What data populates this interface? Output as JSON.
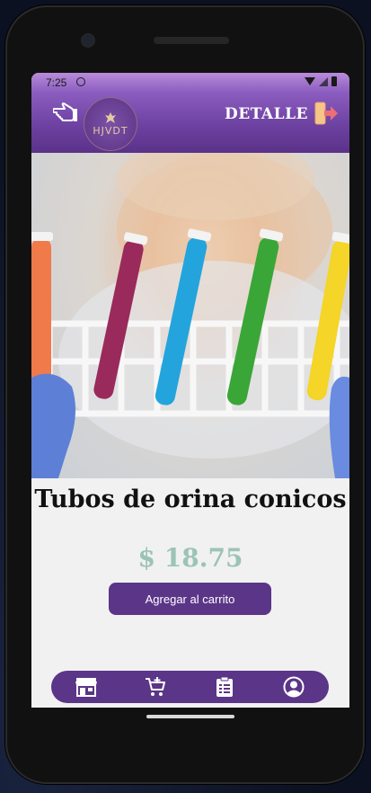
{
  "status_bar": {
    "time": "7:25"
  },
  "header": {
    "title": "DETALLE",
    "logo_text": "HJVDT",
    "back_icon": "hand-pointing-left-icon",
    "logout_icon": "exit-door-icon",
    "gradient_top": "#b88bd9",
    "gradient_bottom": "#5a3289"
  },
  "product": {
    "name": "Tubos de orina conicos",
    "price": "$ 18.75",
    "price_color": "#9cc4b6",
    "image_alt": "test-tubes-rack-photo",
    "add_to_cart_label": "Agregar al carrito"
  },
  "bottom_nav": {
    "items": [
      {
        "icon": "store-icon"
      },
      {
        "icon": "add-to-cart-icon"
      },
      {
        "icon": "clipboard-list-icon"
      },
      {
        "icon": "user-profile-icon"
      }
    ],
    "background": "#5b3587"
  },
  "colors": {
    "accent": "#5b3587",
    "screen_bg": "#f1f1f1"
  }
}
